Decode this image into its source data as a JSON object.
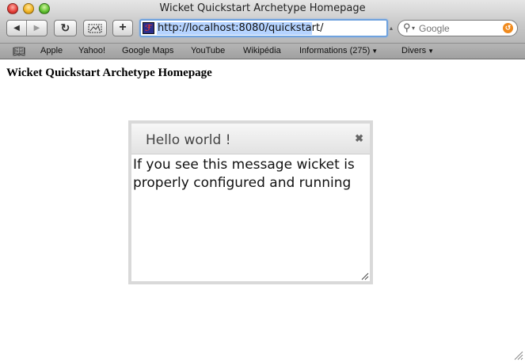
{
  "window": {
    "title": "Wicket Quickstart Archetype Homepage"
  },
  "toolbar": {
    "back_icon": "back-arrow-icon",
    "forward_icon": "forward-arrow-icon",
    "reload_icon": "reload-icon",
    "snapshot_icon": "snapshot-icon",
    "add_bookmark_icon": "plus-icon",
    "address": {
      "favicon": "wicket-favicon",
      "value": "http://localhost:8080/quickstart/"
    },
    "search": {
      "placeholder": "Google"
    }
  },
  "bookmarks": {
    "items": [
      {
        "label": "Apple"
      },
      {
        "label": "Yahoo!"
      },
      {
        "label": "Google Maps"
      },
      {
        "label": "YouTube"
      },
      {
        "label": "Wikipédia"
      },
      {
        "label": "Informations (275)"
      },
      {
        "label": "Divers"
      }
    ]
  },
  "page": {
    "heading": "Wicket Quickstart Archetype Homepage",
    "dialog": {
      "title": "Hello world !",
      "message": "If you see this message wicket is properly configured and running"
    }
  },
  "colors": {
    "address_focus": "#6fa2de",
    "selection": "#b5d3ff",
    "snapback": "#f08a1d"
  }
}
